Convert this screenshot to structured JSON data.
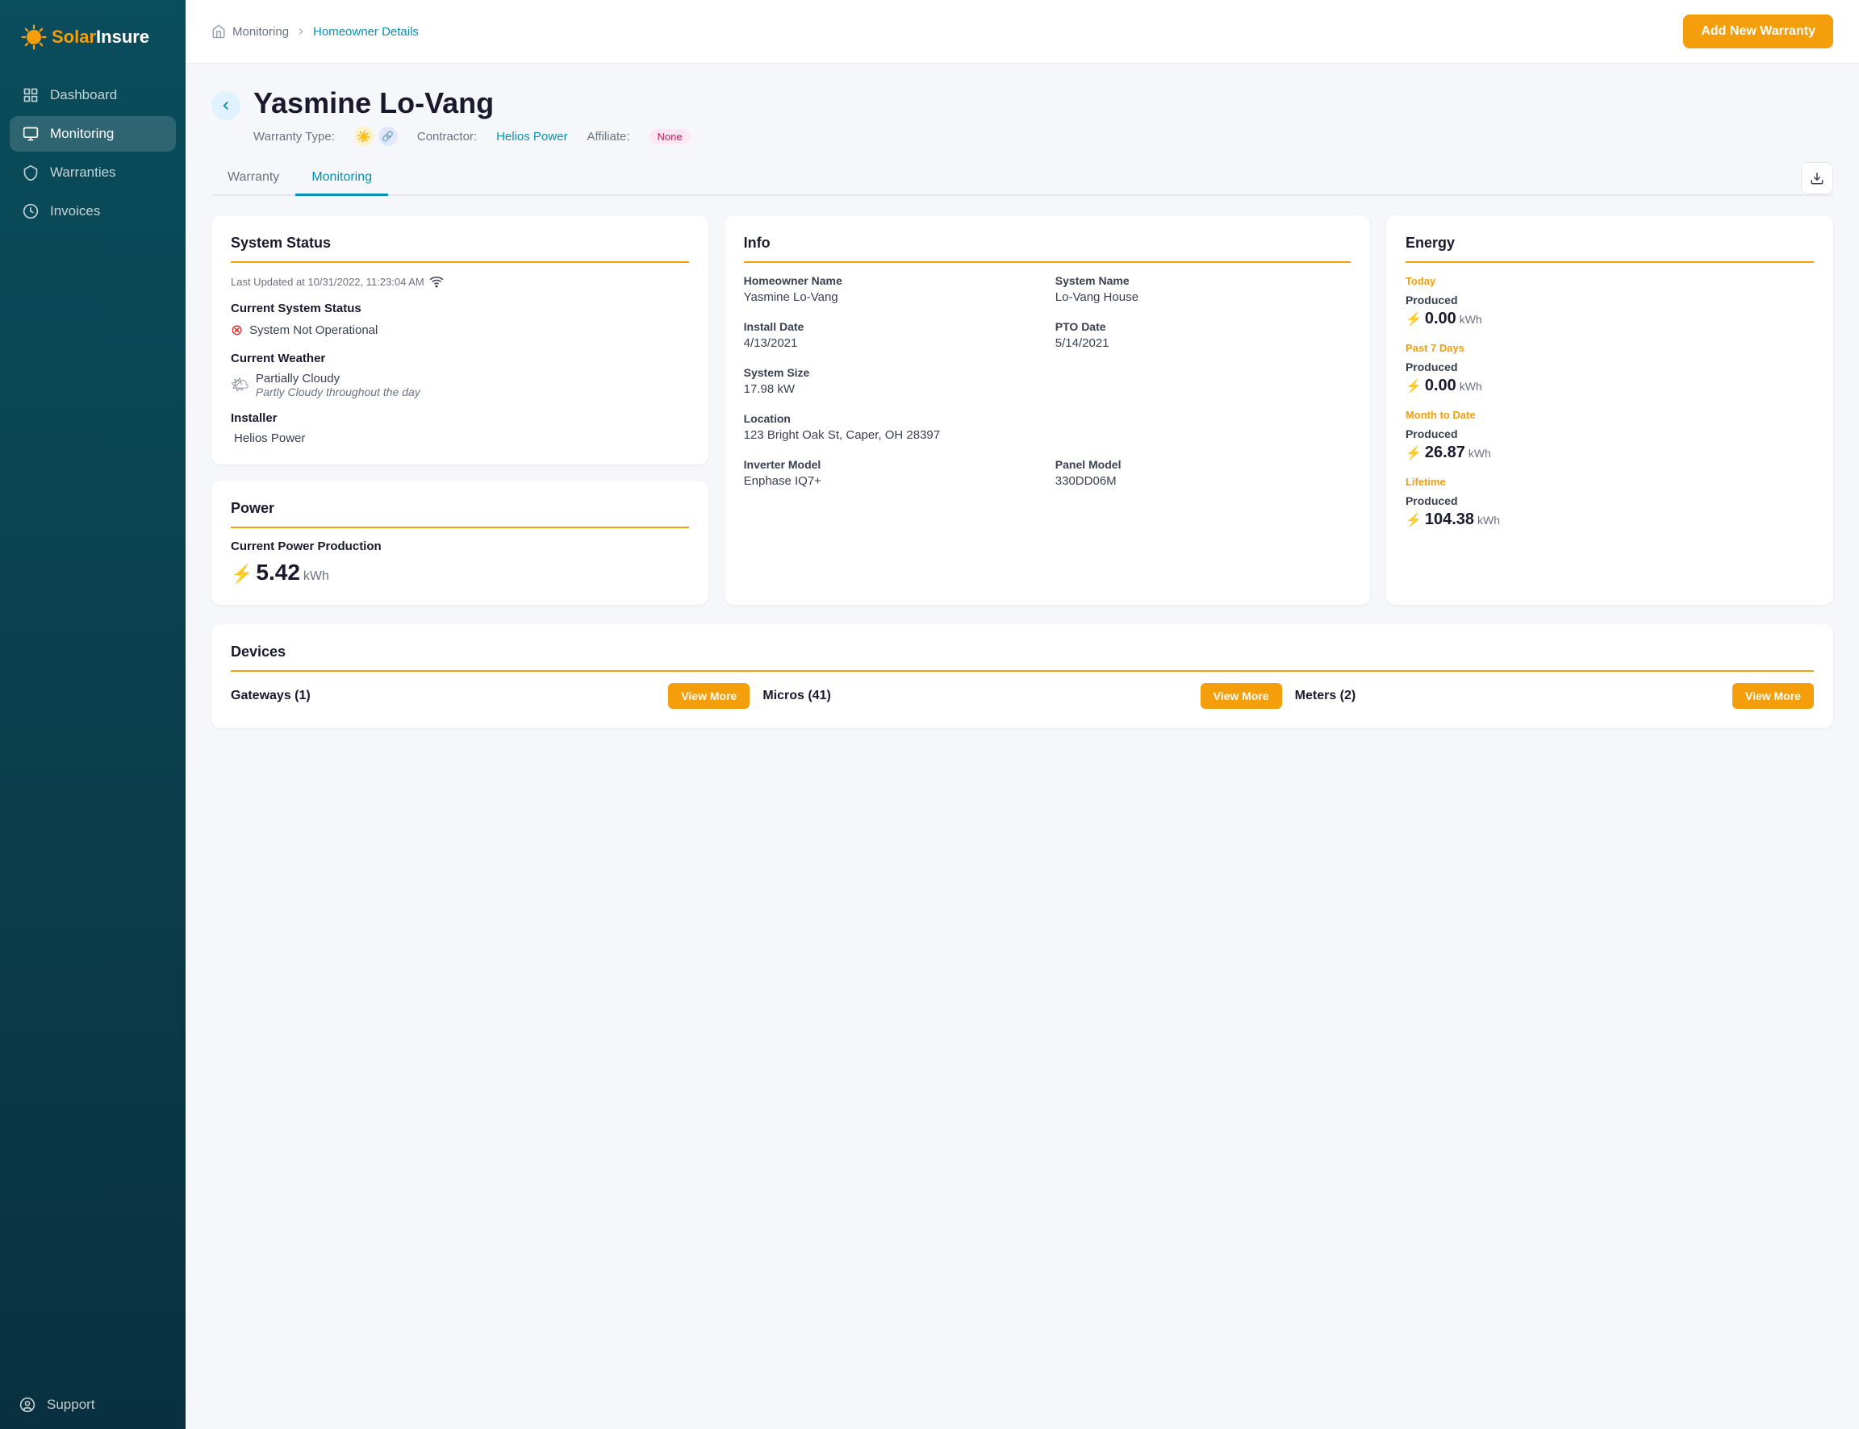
{
  "sidebar": {
    "logo": {
      "text_solar": "Solar",
      "text_insure": "Insure"
    },
    "nav": [
      {
        "id": "dashboard",
        "label": "Dashboard",
        "active": false
      },
      {
        "id": "monitoring",
        "label": "Monitoring",
        "active": true
      },
      {
        "id": "warranties",
        "label": "Warranties",
        "active": false
      },
      {
        "id": "invoices",
        "label": "Invoices",
        "active": false
      }
    ],
    "support": {
      "label": "Support"
    }
  },
  "header": {
    "breadcrumb": {
      "parent": "Monitoring",
      "current": "Homeowner Details"
    },
    "add_warranty_btn": "Add New Warranty"
  },
  "homeowner": {
    "name": "Yasmine Lo-Vang",
    "warranty_type_label": "Warranty Type:",
    "contractor_label": "Contractor:",
    "contractor_name": "Helios Power",
    "affiliate_label": "Affiliate:",
    "affiliate_value": "None"
  },
  "tabs": [
    {
      "id": "warranty",
      "label": "Warranty",
      "active": false
    },
    {
      "id": "monitoring",
      "label": "Monitoring",
      "active": true
    }
  ],
  "system_status": {
    "card_title": "System Status",
    "last_updated": "Last Updated at 10/31/2022, 11:23:04 AM",
    "current_status_label": "Current System Status",
    "current_status_value": "System Not Operational",
    "weather_label": "Current Weather",
    "weather_main": "Partially Cloudy",
    "weather_desc": "Partly Cloudy throughout the day",
    "installer_label": "Installer",
    "installer_name": "Helios Power"
  },
  "power": {
    "card_title": "Power",
    "current_label": "Current Power Production",
    "value": "5.42",
    "unit": "kWh"
  },
  "info": {
    "card_title": "Info",
    "homeowner_name_label": "Homeowner Name",
    "homeowner_name": "Yasmine Lo-Vang",
    "system_name_label": "System Name",
    "system_name": "Lo-Vang House",
    "install_date_label": "Install Date",
    "install_date": "4/13/2021",
    "pto_date_label": "PTO Date",
    "pto_date": "5/14/2021",
    "system_size_label": "System Size",
    "system_size": "17.98 kW",
    "location_label": "Location",
    "location": "123 Bright Oak St, Caper, OH 28397",
    "inverter_model_label": "Inverter Model",
    "inverter_model": "Enphase IQ7+",
    "panel_model_label": "Panel Model",
    "panel_model": "330DD06M"
  },
  "energy": {
    "card_title": "Energy",
    "periods": [
      {
        "id": "today",
        "label": "Today",
        "produced_label": "Produced",
        "value": "0.00",
        "unit": "kWh"
      },
      {
        "id": "past7days",
        "label": "Past 7 Days",
        "produced_label": "Produced",
        "value": "0.00",
        "unit": "kWh"
      },
      {
        "id": "monthtodate",
        "label": "Month to Date",
        "produced_label": "Produced",
        "value": "26.87",
        "unit": "kWh"
      },
      {
        "id": "lifetime",
        "label": "Lifetime",
        "produced_label": "Produced",
        "value": "104.38",
        "unit": "kWh"
      }
    ]
  },
  "devices": {
    "card_title": "Devices",
    "items": [
      {
        "name": "Gateways (1)",
        "btn": "View More"
      },
      {
        "name": "Micros (41)",
        "btn": "View More"
      },
      {
        "name": "Meters (2)",
        "btn": "View More"
      }
    ]
  }
}
